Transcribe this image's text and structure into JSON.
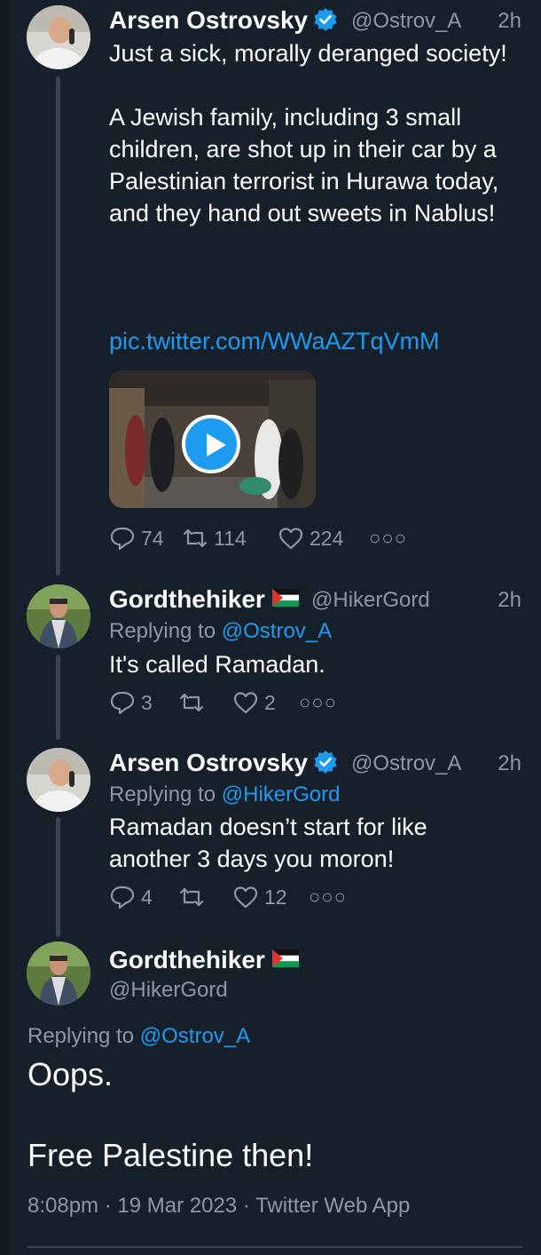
{
  "tweets": [
    {
      "name": "Arsen Ostrovsky",
      "handle": "@Ostrov_A",
      "time": "2h",
      "text": "Just a sick, morally deranged society!\n\nA Jewish family, including 3 small children, are shot up in their car by a Palestinian terrorist in Hurawa today, and they hand out sweets in Nablus!",
      "link": "pic.twitter.com/WWaAZTqVmM",
      "replies": "74",
      "retweets": "114",
      "likes": "224"
    },
    {
      "name": "Gordthehiker",
      "handle": "@HikerGord",
      "time": "2h",
      "replying_label": "Replying to",
      "replying_to": "@Ostrov_A",
      "text": "It's called Ramadan.",
      "replies": "3",
      "retweets": "",
      "likes": "2"
    },
    {
      "name": "Arsen Ostrovsky",
      "handle": "@Ostrov_A",
      "time": "2h",
      "replying_label": "Replying to",
      "replying_to": "@HikerGord",
      "text": "Ramadan doesn’t start for like another 3 days you moron!",
      "replies": "4",
      "retweets": "",
      "likes": "12"
    }
  ],
  "main_tweet": {
    "name": "Gordthehiker",
    "handle": "@HikerGord",
    "replying_label": "Replying to",
    "replying_to": "@Ostrov_A",
    "line1": "Oops.",
    "line2": "Free Palestine then!",
    "meta": "8:08pm · 19 Mar 2023 · Twitter Web App"
  },
  "icons": {
    "verified": "verified-badge-icon",
    "flag": "palestine-flag-icon",
    "reply": "reply-icon",
    "retweet": "retweet-icon",
    "like": "heart-icon",
    "more": "more-icon",
    "play": "play-icon"
  },
  "colors": {
    "background": "#15202b",
    "accent": "#1d9bf0",
    "secondary_text": "#8b98a5"
  }
}
